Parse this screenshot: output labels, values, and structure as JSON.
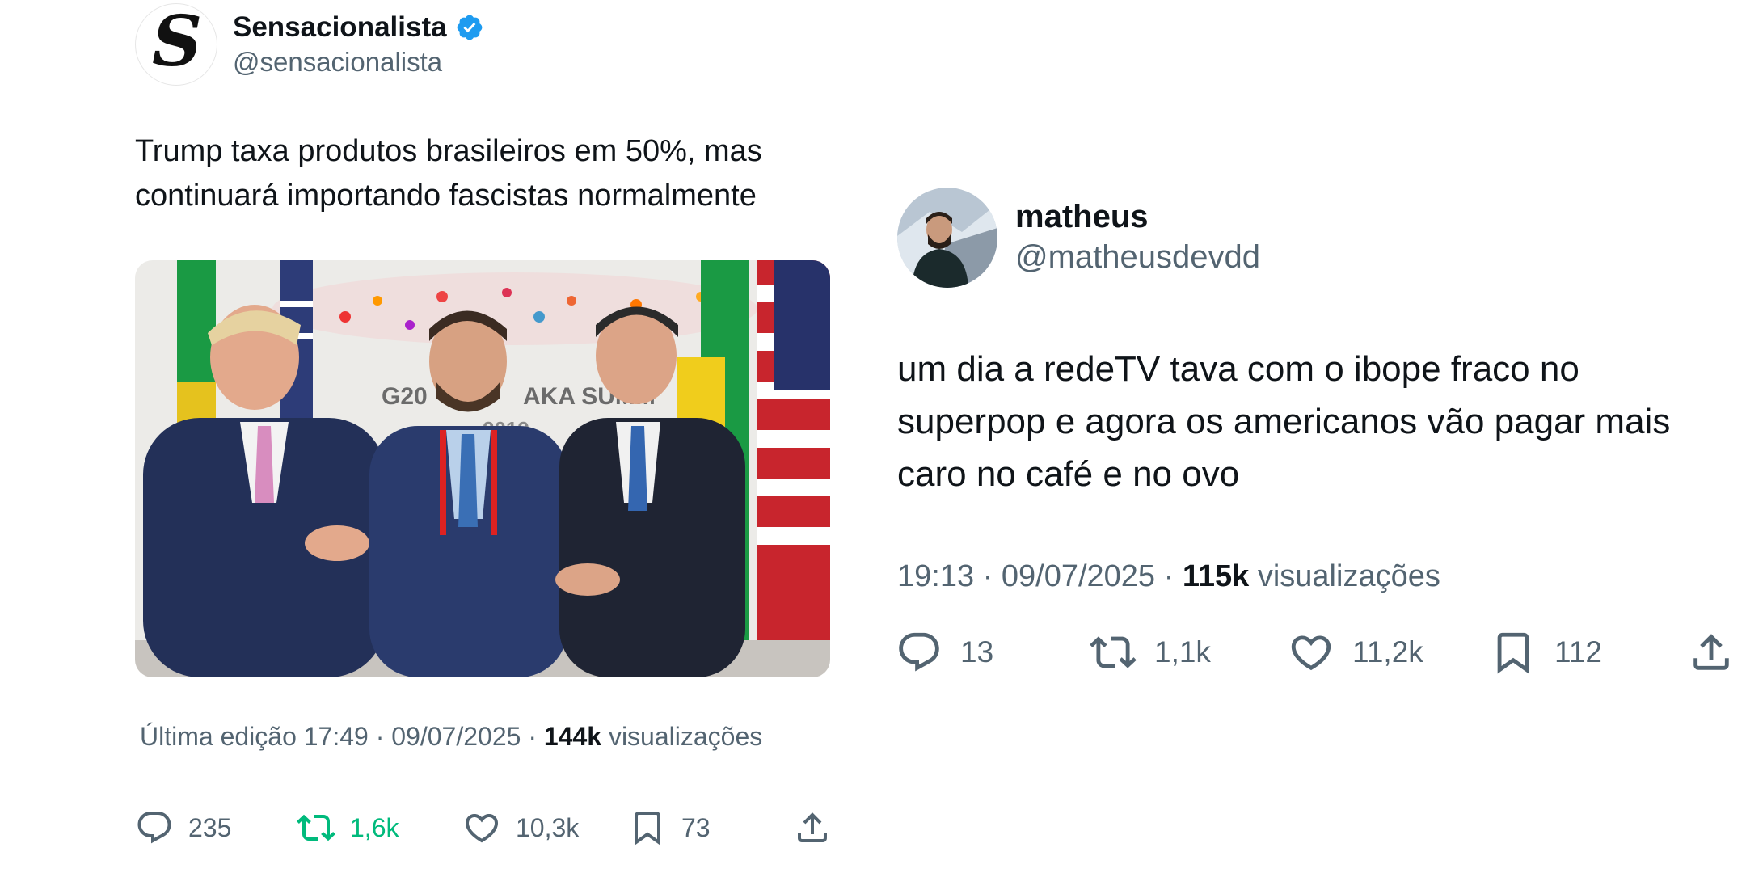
{
  "left_tweet": {
    "author": {
      "name": "Sensacionalista",
      "handle": "@sensacionalista",
      "avatar_letter": "S"
    },
    "text": "Trump taxa produtos brasileiros em 50%, mas continuará importando fascistas normalmente",
    "image": {
      "banner_text_1": "G20",
      "banner_text_2": "AKA SUMM",
      "banner_year": "2019"
    },
    "meta": {
      "edited": "Última edição 17:49 · 09/07/2025",
      "sep": " · ",
      "views": "144k",
      "views_label": "visualizações"
    },
    "actions": {
      "replies": "235",
      "retweets": "1,6k",
      "likes": "10,3k",
      "bookmarks": "73"
    },
    "colors": {
      "retweet_active": "#00ba7c",
      "verified": "#1d9bf0"
    }
  },
  "right_tweet": {
    "author": {
      "name": "matheus",
      "handle": "@matheusdevdd"
    },
    "text": "um dia a redeTV tava com o ibope fraco no superpop e agora os americanos vão pagar mais caro no café e no ovo",
    "meta": {
      "time": "19:13 · 09/07/2025 · ",
      "views": "115k",
      "views_label": "visualizações"
    },
    "actions": {
      "replies": "13",
      "retweets": "1,1k",
      "likes": "11,2k",
      "bookmarks": "112"
    }
  },
  "icons": [
    "reply-icon",
    "retweet-icon",
    "like-icon",
    "bookmark-icon",
    "share-icon",
    "verified-badge-icon"
  ]
}
